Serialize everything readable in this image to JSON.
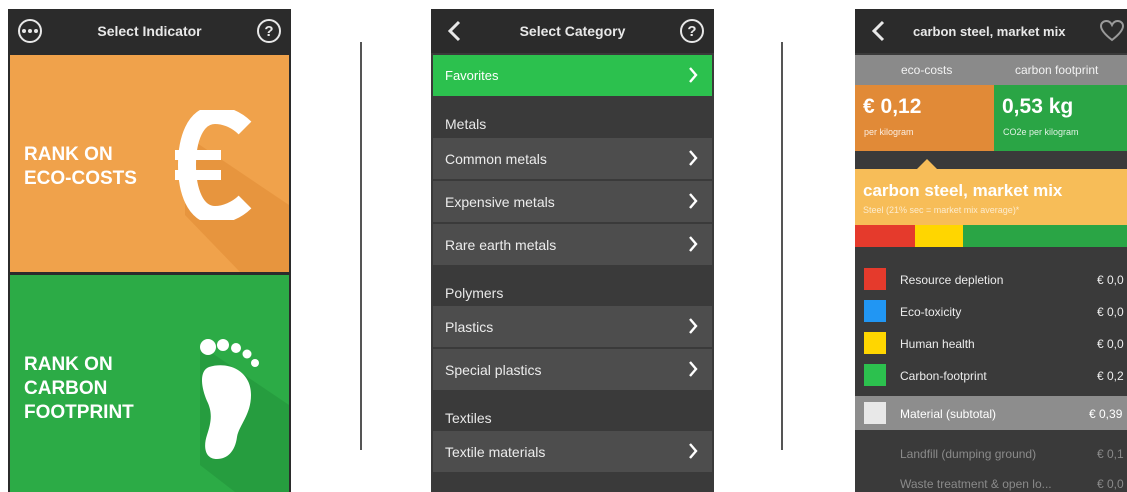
{
  "panel1": {
    "title": "Select Indicator",
    "menu_icon": "more-dots-icon",
    "help_icon": "help-icon",
    "help_label": "?",
    "eco_tile": {
      "line1": "RANK ON",
      "line2": "ECO-COSTS",
      "icon": "euro-icon",
      "color": "#f0a24b"
    },
    "carbon_tile": {
      "line1": "RANK ON",
      "line2": "CARBON",
      "line3": "FOOTPRINT",
      "icon": "footprint-icon",
      "color": "#2cab46"
    }
  },
  "panel2": {
    "title": "Select Category",
    "help_label": "?",
    "favorites": "Favorites",
    "sections": [
      {
        "heading": "Metals",
        "items": [
          "Common metals",
          "Expensive metals",
          "Rare earth metals"
        ]
      },
      {
        "heading": "Polymers",
        "items": [
          "Plastics",
          "Special plastics"
        ]
      },
      {
        "heading": "Textiles",
        "items": [
          "Textile materials"
        ]
      }
    ]
  },
  "panel3": {
    "title": "carbon steel, market mix",
    "tabs": {
      "eco": "eco-costs",
      "carbon": "carbon footprint"
    },
    "eco_value": "€ 0,12",
    "eco_unit": "per kilogram",
    "carbon_value": "0,53 kg",
    "carbon_unit": "CO2e per kilogram",
    "material_title": "carbon steel, market mix",
    "material_sub": "Steel (21% sec = market mix average)*",
    "impacts": [
      {
        "name": "Resource depletion",
        "value": "€ 0,0",
        "color": "#e53a2c"
      },
      {
        "name": "Eco-toxicity",
        "value": "€ 0,0",
        "color": "#2196f3"
      },
      {
        "name": "Human health",
        "value": "€ 0,0",
        "color": "#ffd600"
      },
      {
        "name": "Carbon-footprint",
        "value": "€ 0,2",
        "color": "#2cc14e"
      }
    ],
    "subtotal": {
      "name": "Material (subtotal)",
      "value": "€ 0,39"
    },
    "extra_rows": [
      {
        "name": "Landfill (dumping ground)",
        "value": "€ 0,1"
      },
      {
        "name": "Waste treatment & open lo...",
        "value": "€ 0,0"
      }
    ]
  }
}
